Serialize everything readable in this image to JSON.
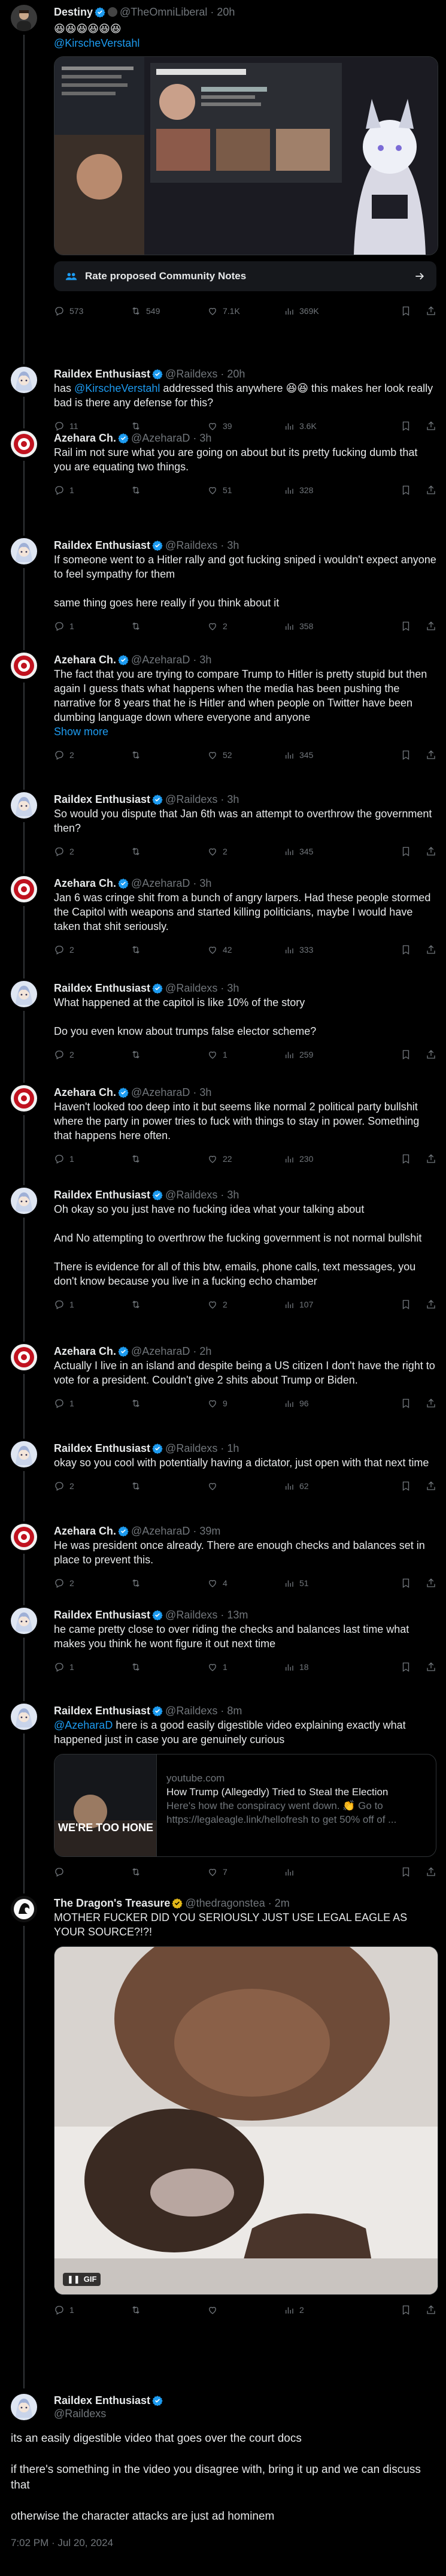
{
  "colors": {
    "accent": "#1d9bf0",
    "background": "#000000",
    "text": "#e7e9ea",
    "muted": "#71767b",
    "gold_verified": "#e2b719"
  },
  "tweets": [
    {
      "name": "Destiny",
      "handle": "@TheOmniLiberal",
      "time": "20h",
      "emoji_line": "😆😆😆😆😆😆",
      "mention": "@KirscheVerstahl",
      "notes_button": "Rate proposed Community Notes",
      "media_caption": "Rate proposed Community Notes",
      "stats": {
        "replies": "573",
        "reposts": "549",
        "likes": "7.1K",
        "views": "369K"
      }
    },
    {
      "name": "Raildex Enthusiast",
      "handle": "@Raildexs",
      "time": "20h",
      "text_pre": "has ",
      "mention": "@KirscheVerstahl",
      "text_post": " addressed this anywhere 😆😆 this makes her look really bad is there any defense for this?",
      "stats": {
        "replies": "11",
        "reposts": "",
        "likes": "39",
        "views": "3.6K"
      }
    },
    {
      "name": "Azehara Ch.",
      "handle": "@AzeharaD",
      "time": "3h",
      "text": "Rail im not sure what you are going on about but its pretty fucking dumb that you are equating two things.",
      "stats": {
        "replies": "1",
        "reposts": "",
        "likes": "51",
        "views": "328"
      }
    },
    {
      "name": "Raildex Enthusiast",
      "handle": "@Raildexs",
      "time": "3h",
      "text": "If someone went to a Hitler rally and got fucking sniped i wouldn't expect anyone to feel sympathy for them",
      "text2": "same thing goes here really if you think about it",
      "stats": {
        "replies": "1",
        "reposts": "",
        "likes": "2",
        "views": "358"
      }
    },
    {
      "name": "Azehara Ch.",
      "handle": "@AzeharaD",
      "time": "3h",
      "text": "The fact that you are trying to compare Trump to Hitler is pretty stupid but then again I guess thats what happens when the media has been pushing the narrative for 8 years that he is Hitler and when people on Twitter have been dumbing language down where everyone and anyone",
      "show_more": "Show more",
      "stats": {
        "replies": "2",
        "reposts": "",
        "likes": "52",
        "views": "345"
      }
    },
    {
      "name": "Raildex Enthusiast",
      "handle": "@Raildexs",
      "time": "3h",
      "text": "So would you dispute that Jan 6th was an attempt to overthrow the government then?",
      "stats": {
        "replies": "2",
        "reposts": "",
        "likes": "2",
        "views": "345"
      }
    },
    {
      "name": "Azehara Ch.",
      "handle": "@AzeharaD",
      "time": "3h",
      "text": "Jan 6 was cringe shit from a bunch of angry larpers.  Had these people stormed the Capitol with weapons and started killing politicians, maybe I would have taken that shit seriously.",
      "stats": {
        "replies": "2",
        "reposts": "",
        "likes": "42",
        "views": "333"
      }
    },
    {
      "name": "Raildex Enthusiast",
      "handle": "@Raildexs",
      "time": "3h",
      "text": "What happened at the capitol is like 10% of the story",
      "text2": "Do you even know about trumps false elector scheme?",
      "stats": {
        "replies": "2",
        "reposts": "",
        "likes": "1",
        "views": "259"
      }
    },
    {
      "name": "Azehara Ch.",
      "handle": "@AzeharaD",
      "time": "3h",
      "text": "Haven't looked too deep into it but seems like normal 2 political party bullshit where the party in power tries to fuck with things to stay in power.  Something that happens here often.",
      "stats": {
        "replies": "1",
        "reposts": "",
        "likes": "22",
        "views": "230"
      }
    },
    {
      "name": "Raildex Enthusiast",
      "handle": "@Raildexs",
      "time": "3h",
      "text": "Oh okay so you just have no fucking idea what your talking about",
      "text2": "And No attempting to overthrow the fucking government is not normal bullshit",
      "text3": "There is evidence for all of this btw, emails, phone calls, text messages, you don't know because you live in a fucking echo chamber",
      "stats": {
        "replies": "1",
        "reposts": "",
        "likes": "2",
        "views": "107"
      }
    },
    {
      "name": "Azehara Ch.",
      "handle": "@AzeharaD",
      "time": "2h",
      "text": "Actually I live in an island and despite being a US citizen I don't have the right to vote for a president.  Couldn't give 2 shits about Trump or Biden.",
      "stats": {
        "replies": "1",
        "reposts": "",
        "likes": "9",
        "views": "96"
      }
    },
    {
      "name": "Raildex Enthusiast",
      "handle": "@Raildexs",
      "time": "1h",
      "text": "okay so you cool with potentially having a dictator, just open with that next time",
      "stats": {
        "replies": "2",
        "reposts": "",
        "likes": "",
        "views": "62"
      }
    },
    {
      "name": "Azehara Ch.",
      "handle": "@AzeharaD",
      "time": "39m",
      "text": "He was president once already.  There are enough checks and balances set in place to prevent this.",
      "stats": {
        "replies": "2",
        "reposts": "",
        "likes": "4",
        "views": "51"
      }
    },
    {
      "name": "Raildex Enthusiast",
      "handle": "@Raildexs",
      "time": "13m",
      "text": "he came pretty close to over riding the checks and balances last time what makes you think he wont figure it out next time",
      "stats": {
        "replies": "1",
        "reposts": "",
        "likes": "1",
        "views": "18"
      }
    },
    {
      "name": "Raildex Enthusiast",
      "handle": "@Raildexs",
      "time": "8m",
      "mention": "@AzeharaD",
      "text_post": " here is a good easily digestible video explaining exactly what happened just in case you are genuinely curious",
      "card": {
        "domain": "youtube.com",
        "title": "How Trump (Allegedly) Tried to Steal the Election",
        "desc": "Here's how the conspiracy went down. 👏 Go to https://legaleagle.link/hellofresh to get 50% off of ...",
        "thumb_text": "WE'RE TOO HONE"
      },
      "stats": {
        "replies": "",
        "reposts": "",
        "likes": "7",
        "views": ""
      }
    },
    {
      "name": "The Dragon's Treasure",
      "handle": "@thedragonstea",
      "time": "2m",
      "text": "MOTHER FUCKER DID YOU SERIOUSLY JUST USE LEGAL EAGLE AS YOUR SOURCE?!?!",
      "gif_badge": "GIF",
      "stats": {
        "replies": "1",
        "reposts": "",
        "likes": "",
        "views": "2"
      }
    }
  ],
  "main_tweet": {
    "name": "Raildex Enthusiast",
    "handle": "@Raildexs",
    "text": "its an easily digestible video that goes over the court docs",
    "text2": "if there's something in the video you disagree with, bring it up and we can discuss that",
    "text3": "otherwise the character attacks are just ad hominem",
    "timestamp": "7:02 PM · Jul 20, 2024"
  }
}
